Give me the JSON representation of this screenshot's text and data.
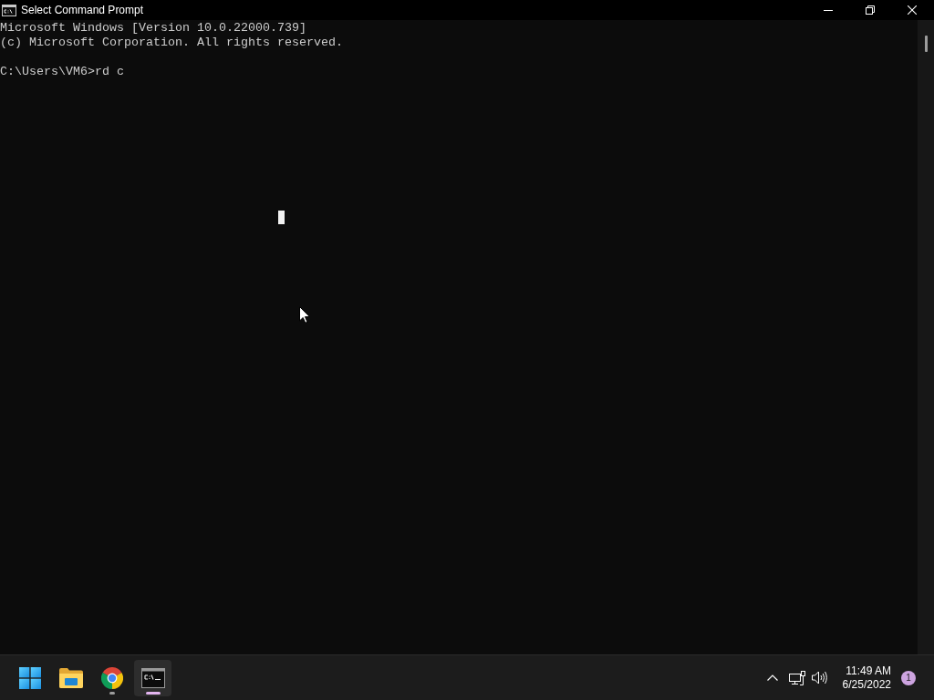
{
  "window": {
    "title": "Select Command Prompt"
  },
  "console": {
    "banner": [
      "Microsoft Windows [Version 10.0.22000.739]",
      "(c) Microsoft Corporation. All rights reserved."
    ],
    "prompt": "C:\\Users\\VM6>rd c"
  },
  "taskbar": {
    "apps": [
      {
        "kind": "start",
        "running": false,
        "selected": false
      },
      {
        "kind": "folder",
        "running": false,
        "selected": false
      },
      {
        "kind": "browser",
        "running": true,
        "selected": false
      },
      {
        "kind": "terminal",
        "running": true,
        "selected": true
      }
    ]
  },
  "tray": {
    "time": "11:49 AM",
    "date": "6/25/2022",
    "notification_count": "1"
  }
}
